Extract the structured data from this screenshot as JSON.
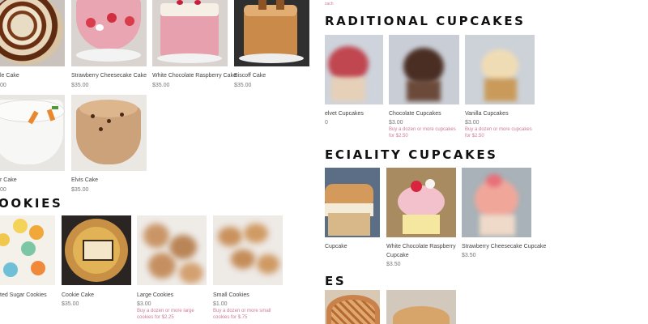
{
  "left": {
    "cakes": [
      {
        "name": "le Cake",
        "price": "00"
      },
      {
        "name": "Strawberry Cheesecake Cake",
        "price": "$35.00"
      },
      {
        "name": "White Chocolate Raspberry Cake",
        "price": "$35.00"
      },
      {
        "name": "Biscoff Cake",
        "price": "$35.00"
      },
      {
        "name": "r Cake",
        "price": "00"
      },
      {
        "name": "Elvis Cake",
        "price": "$35.00"
      }
    ],
    "cookies_heading": "OOKIES",
    "cookies": [
      {
        "name": "ted Sugar Cookies",
        "price": "",
        "note": ""
      },
      {
        "name": "Cookie Cake",
        "price": "$35.00",
        "note": ""
      },
      {
        "name": "Large Cookies",
        "price": "$3.00",
        "note": "Buy a dozen or more large cookies for $2.25"
      },
      {
        "name": "Small Cookies",
        "price": "$1.00",
        "note": "Buy a dozen or more small cookies for $.75"
      }
    ]
  },
  "right": {
    "top_note": "zach",
    "traditional_heading": "RADITIONAL CUPCAKES",
    "traditional": [
      {
        "name": "elvet Cupcakes",
        "price": "0",
        "note": ""
      },
      {
        "name": "Chocolate Cupcakes",
        "price": "$3.00",
        "note": "Buy a dozen or more cupcakes for $2.50"
      },
      {
        "name": "Vanilla Cupcakes",
        "price": "$3.00",
        "note": "Buy a dozen or more cupcakes for $2.50"
      }
    ],
    "speciality_heading": "ECIALITY CUPCAKES",
    "speciality": [
      {
        "name": "Cupcake",
        "price": "",
        "line2": ""
      },
      {
        "name": "White Chocolate Raspberry",
        "line2": "Cupcake",
        "price": "$3.50"
      },
      {
        "name": "Strawberry Cheesecake Cupcake",
        "line2": "",
        "price": "$3.50"
      }
    ],
    "pies_heading": "ES"
  }
}
